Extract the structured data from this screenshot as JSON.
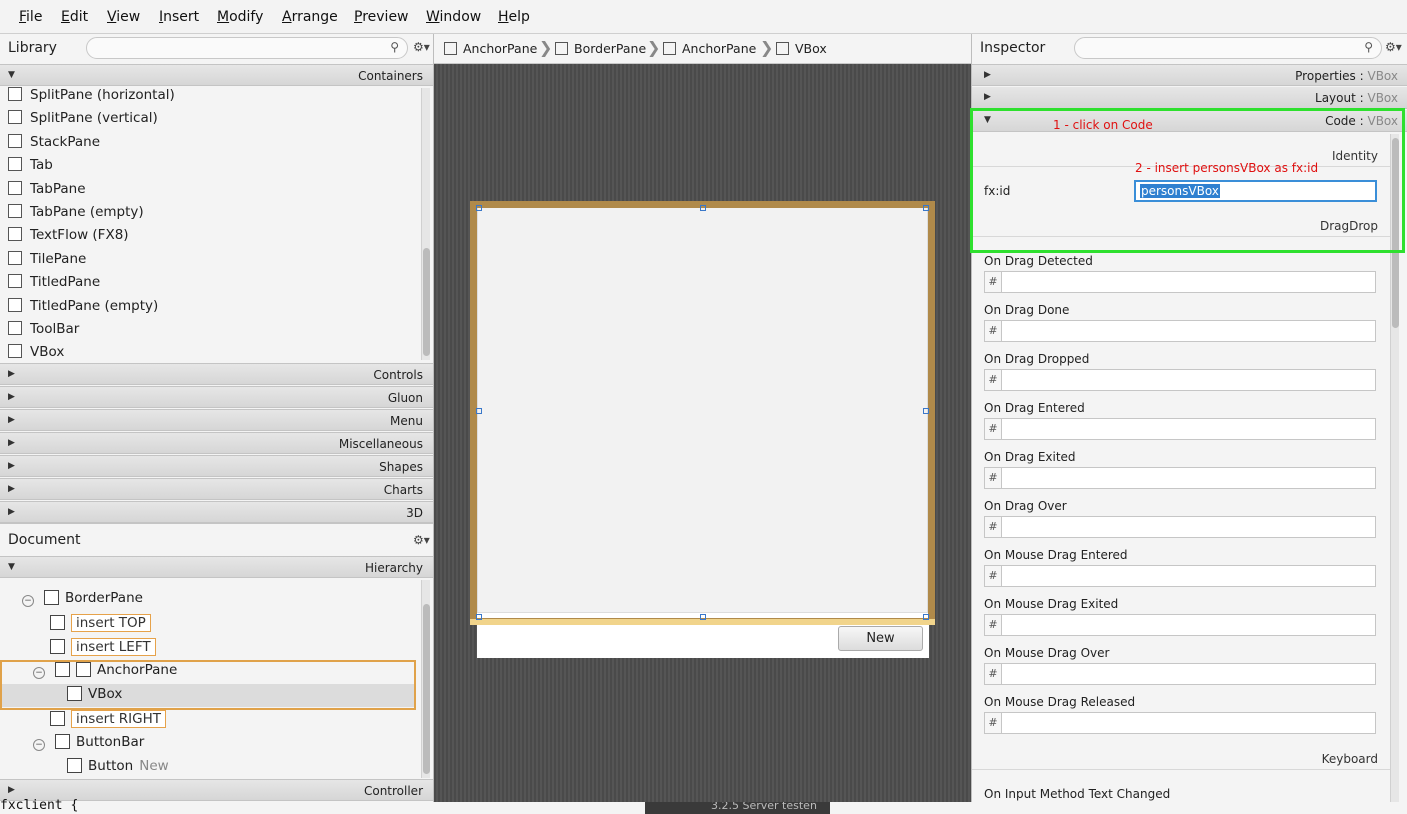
{
  "menu": [
    "File",
    "Edit",
    "View",
    "Insert",
    "Modify",
    "Arrange",
    "Preview",
    "Window",
    "Help"
  ],
  "menu_mnemonics": [
    "F",
    "E",
    "V",
    "I",
    "M",
    "A",
    "P",
    "W",
    "H"
  ],
  "library": {
    "title": "Library",
    "containers_label": "Containers",
    "items": [
      "SplitPane  (horizontal)",
      "SplitPane  (vertical)",
      "StackPane",
      "Tab",
      "TabPane",
      "TabPane  (empty)",
      "TextFlow  (FX8)",
      "TilePane",
      "TitledPane",
      "TitledPane  (empty)",
      "ToolBar",
      "VBox"
    ],
    "sections": [
      "Controls",
      "Gluon",
      "Menu",
      "Miscellaneous",
      "Shapes",
      "Charts",
      "3D"
    ]
  },
  "document": {
    "title": "Document",
    "hierarchy_label": "Hierarchy",
    "tree": [
      {
        "label": "BorderPane",
        "indent": 1,
        "collapse": true
      },
      {
        "label": "insert TOP",
        "indent": 2,
        "insert": true
      },
      {
        "label": "insert LEFT",
        "indent": 2,
        "insert": true
      },
      {
        "label": "AnchorPane",
        "indent": 2,
        "collapse": true,
        "selected": true
      },
      {
        "label": "VBox",
        "indent": 3,
        "selected": true
      },
      {
        "label": "insert RIGHT",
        "indent": 2,
        "insert": true
      },
      {
        "label": "ButtonBar",
        "indent": 2,
        "collapse": true
      },
      {
        "label": "Button",
        "indent": 3,
        "extra": "New"
      }
    ],
    "controller_label": "Controller"
  },
  "breadcrumbs": [
    "AnchorPane",
    "BorderPane",
    "AnchorPane",
    "VBox"
  ],
  "canvas": {
    "button_label": "New"
  },
  "inspector": {
    "title": "Inspector",
    "sections": [
      {
        "label": "Properties",
        "sub": "VBox"
      },
      {
        "label": "Layout",
        "sub": "VBox"
      },
      {
        "label": "Code",
        "sub": "VBox"
      }
    ],
    "identity_label": "Identity",
    "fxid_label": "fx:id",
    "fxid_value": "personsVBox",
    "dragdrop_label": "DragDrop",
    "events": [
      "On Drag Detected",
      "On Drag Done",
      "On Drag Dropped",
      "On Drag Entered",
      "On Drag Exited",
      "On Drag Over",
      "On Mouse Drag Entered",
      "On Mouse Drag Exited",
      "On Mouse Drag Over",
      "On Mouse Drag Released"
    ],
    "keyboard_label": "Keyboard",
    "last_event": "On Input Method Text Changed",
    "annotations": [
      "1 - click on Code",
      "2 - insert personsVBox as fx:id"
    ]
  },
  "footer": {
    "code_text": "fxclient {",
    "task_text": "3.2.5 Server testen"
  }
}
